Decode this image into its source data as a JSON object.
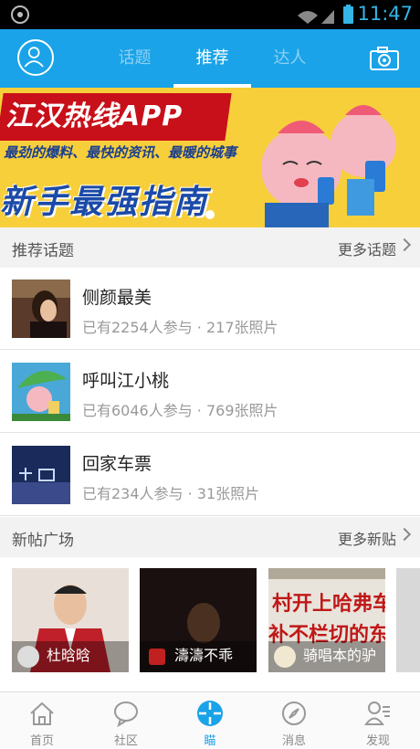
{
  "status_bar": {
    "time": "11:47"
  },
  "header": {
    "tabs": [
      {
        "label": "话题"
      },
      {
        "label": "推荐"
      },
      {
        "label": "达人"
      }
    ],
    "active_tab": "推荐"
  },
  "banner": {
    "title": "江汉热线APP",
    "slogan": "最劲的爆料、最快的资讯、最暖的城事",
    "guide": "新手最强指南"
  },
  "topics_section": {
    "label": "推荐话题",
    "more": "更多话题",
    "items": [
      {
        "name": "侧颜最美",
        "meta": "已有2254人参与 · 217张照片"
      },
      {
        "name": "呼叫江小桃",
        "meta": "已有6046人参与 · 769张照片"
      },
      {
        "name": "回家车票",
        "meta": "已有234人参与 · 31张照片"
      }
    ]
  },
  "posts_section": {
    "label": "新帖广场",
    "more": "更多新贴",
    "items": [
      {
        "user": "杜晗晗"
      },
      {
        "user": "濤濤不乖"
      },
      {
        "user": "骑唱本的驴"
      }
    ]
  },
  "bottom_nav": {
    "items": [
      {
        "label": "首页",
        "icon": "home-icon"
      },
      {
        "label": "社区",
        "icon": "chat-bubble-icon"
      },
      {
        "label": "瞄",
        "icon": "crosshair-icon"
      },
      {
        "label": "消息",
        "icon": "compass-icon"
      },
      {
        "label": "发现",
        "icon": "person-list-icon"
      }
    ],
    "active": "瞄"
  },
  "colors": {
    "brand": "#1aa3e8",
    "status_time": "#33b5e5"
  }
}
